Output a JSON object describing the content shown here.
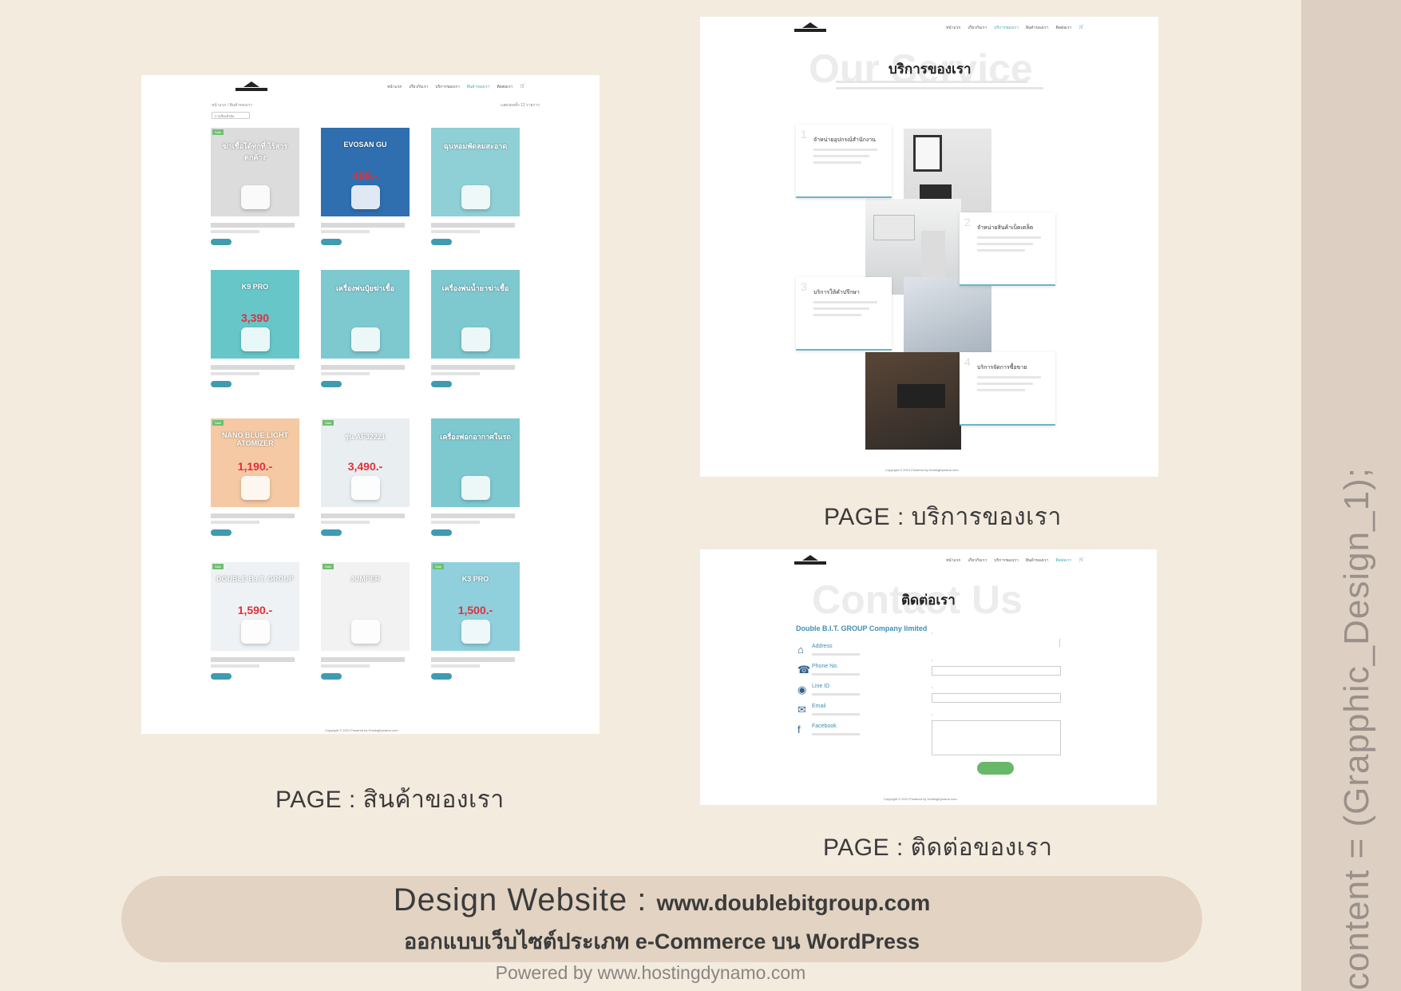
{
  "side_text": "content = (Grapphic_Design_1);",
  "captions": {
    "products": "PAGE : สินค้าของเรา",
    "services": "PAGE : บริการของเรา",
    "contact": "PAGE : ติดต่อของเรา"
  },
  "products_page": {
    "breadcrumb": "หน้าแรก / สินค้าของเรา",
    "result_count": "แสดงผลทั้ง 12 รายการ",
    "sort_label": "การเรียงลำดับ",
    "product_images": [
      {
        "tag": "Sale",
        "headline": "ฆ่าเชื้อได้ทุกที่ ไร้สารตกค้าง",
        "color": "#dcdcdc"
      },
      {
        "tag": "",
        "headline": "EVOSAN GU",
        "price": "499.-",
        "color": "#2f6fb0"
      },
      {
        "tag": "",
        "headline": "ฉุนหอมพัดลมสะอาด",
        "color": "#8fcfd6"
      },
      {
        "tag": "",
        "headline": "K9 PRO",
        "price": "3,390",
        "color": "#66c6c8"
      },
      {
        "tag": "",
        "headline": "เครื่องพ่นปุ๋ยฆ่าเชื้อ",
        "color": "#7ec8d0"
      },
      {
        "tag": "",
        "headline": "เครื่องพ่นน้ำยาฆ่าเชื้อ",
        "color": "#7ec8d0"
      },
      {
        "tag": "Sale",
        "headline": "NANO BLUE LIGHT ATOMIZER",
        "price": "1,190.-",
        "color": "#f4c9a3"
      },
      {
        "tag": "Sale",
        "headline": "รุ่น AF32221",
        "price": "3,490.-",
        "color": "#e9eef0"
      },
      {
        "tag": "",
        "headline": "เครื่องฟอกอากาศในรถ",
        "color": "#7ec8d0"
      },
      {
        "tag": "Sale",
        "headline": "DOUBLE B.I.T. GROUP",
        "price": "1,590.-",
        "color": "#eef2f4"
      },
      {
        "tag": "Sale",
        "headline": "JUMPER",
        "color": "#f2f2f2"
      },
      {
        "tag": "Sale",
        "headline": "K3 PRO",
        "price": "1,500.-",
        "color": "#8fd0dc"
      }
    ],
    "footer": "Copyright © 2021 Powered by HostingDynamo.com"
  },
  "services_page": {
    "ghost_title": "Our Service",
    "title": "บริการของเรา",
    "services": [
      {
        "num": "1",
        "title": "จำหน่ายอุปกรณ์สำนักงาน"
      },
      {
        "num": "2",
        "title": "จำหน่ายสินค้าเบ็ดเตล็ด"
      },
      {
        "num": "3",
        "title": "บริการให้คำปรึกษา"
      },
      {
        "num": "4",
        "title": "บริการจัดการซื้อขาย"
      }
    ],
    "footer": "Copyright © 2021 Powered by HostingDynamo.com"
  },
  "contact_page": {
    "ghost_title": "Contact Us",
    "title": "ติดต่อเรา",
    "company": "Double B.I.T. GROUP Company limited",
    "items": [
      {
        "icon": "home-icon",
        "label": "Address"
      },
      {
        "icon": "phone-icon",
        "label": "Phone No."
      },
      {
        "icon": "line-icon",
        "label": "Line ID"
      },
      {
        "icon": "mail-icon",
        "label": "Email"
      },
      {
        "icon": "facebook-icon",
        "label": "Facebook"
      }
    ],
    "footer": "Copyright © 2021 Powered by HostingDynamo.com"
  },
  "banner": {
    "line1_a": "Design Website : ",
    "line1_b": "www.doublebitgroup.com",
    "line2": "ออกแบบเว็บไซต์ประเภท e-Commerce บน WordPress"
  },
  "powered": "Powered by www.hostingdynamo.com"
}
